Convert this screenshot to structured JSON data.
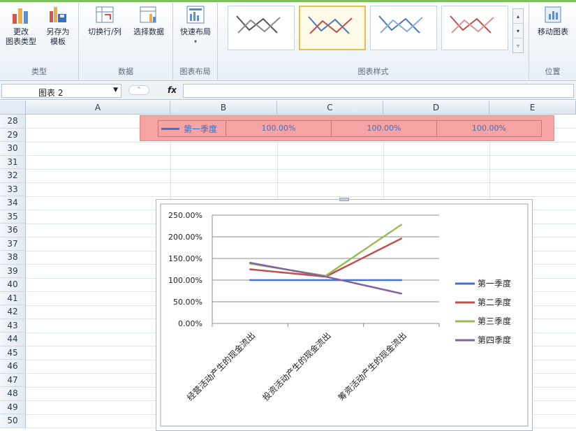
{
  "ribbon": {
    "groups": {
      "type": {
        "label": "类型",
        "change_type_line1": "更改",
        "change_type_line2": "图表类型",
        "save_template_line1": "另存为",
        "save_template_line2": "模板"
      },
      "data": {
        "label": "数据",
        "switch_row_col": "切换行/列",
        "select_data": "选择数据"
      },
      "layout": {
        "label": "图表布局",
        "quick_layout": "快速布局"
      },
      "styles": {
        "label": "图表样式",
        "thumbnails": [
          {
            "color_a": "#555555",
            "color_b": "#8c8c8c"
          },
          {
            "color_a": "#4a78c0",
            "color_b": "#c0504d"
          },
          {
            "color_a": "#4a78c0",
            "color_b": "#8eaad8"
          },
          {
            "color_a": "#c0504d",
            "color_b": "#d99694"
          }
        ]
      },
      "location": {
        "label": "位置",
        "move_chart": "移动图表"
      }
    }
  },
  "formula_bar": {
    "name_box": "图表 2",
    "fx": "fx",
    "value": ""
  },
  "grid": {
    "columns": [
      "A",
      "B",
      "C",
      "D",
      "E"
    ],
    "rows": [
      "28",
      "29",
      "30",
      "31",
      "32",
      "33",
      "34",
      "35",
      "36",
      "37",
      "38",
      "39",
      "40",
      "41",
      "42",
      "43",
      "44",
      "45",
      "46",
      "47",
      "48",
      "49",
      "50"
    ]
  },
  "data_table": {
    "series_name": "第一季度",
    "values": [
      "100.00%",
      "100.00%",
      "100.00%"
    ],
    "accent": "#4472c4"
  },
  "chart_data": {
    "type": "line",
    "categories": [
      "经营活动产生的现金流出",
      "投资活动产生的现金流出",
      "筹资活动产生的现金流出"
    ],
    "yticks": [
      "250.00%",
      "200.00%",
      "150.00%",
      "100.00%",
      "50.00%",
      "0.00%"
    ],
    "ylim": [
      0,
      250
    ],
    "grid": true,
    "legend_position": "right",
    "series": [
      {
        "name": "第一季度",
        "color": "#4472c4",
        "values": [
          100,
          100,
          100
        ]
      },
      {
        "name": "第二季度",
        "color": "#c0504d",
        "values": [
          125,
          108,
          196
        ]
      },
      {
        "name": "第三季度",
        "color": "#9bbb59",
        "values": [
          138,
          110,
          228
        ]
      },
      {
        "name": "第四季度",
        "color": "#8064a2",
        "values": [
          140,
          108,
          69
        ]
      }
    ]
  }
}
